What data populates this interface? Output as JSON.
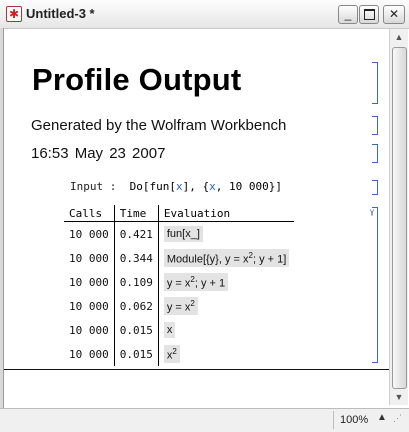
{
  "window": {
    "title": "Untitled-3 *",
    "app_icon": "mathematica-icon",
    "controls": [
      "_",
      "max",
      "✕"
    ]
  },
  "document": {
    "title": "Profile Output",
    "subtitle": "Generated by the Wolfram Workbench",
    "timestamp": "16:53   May 23 2007",
    "input": {
      "label": "Input :",
      "func": "Do[fun[",
      "var1": "x",
      "mid": "], {",
      "var2": "x",
      "end": ", 10 000}]"
    },
    "table": {
      "headers": [
        "Calls",
        "Time",
        "Evaluation"
      ],
      "rows": [
        {
          "calls": "10 000",
          "time": "0.421",
          "evaluation": "fun[x_]"
        },
        {
          "calls": "10 000",
          "time": "0.344",
          "evaluation": "Module[{y}, y = x2; y + 1]"
        },
        {
          "calls": "10 000",
          "time": "0.109",
          "evaluation": "y = x2; y + 1"
        },
        {
          "calls": "10 000",
          "time": "0.062",
          "evaluation": "y = x2"
        },
        {
          "calls": "10 000",
          "time": "0.015",
          "evaluation": "x"
        },
        {
          "calls": "10 000",
          "time": "0.015",
          "evaluation": "x2"
        }
      ]
    }
  },
  "statusbar": {
    "zoom": "100%",
    "zoom_arrow": "▲"
  },
  "colors": {
    "bracket": "#3c6cb4",
    "eval_background": "#e3e3e3"
  }
}
